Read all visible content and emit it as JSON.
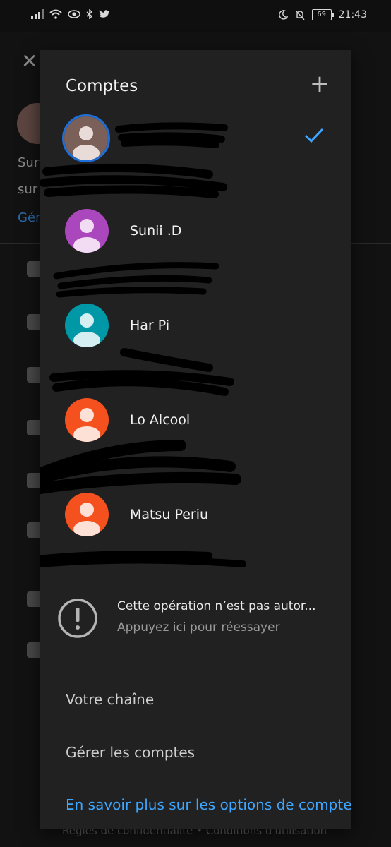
{
  "status_bar": {
    "time": "21:43",
    "battery": "69",
    "icons": [
      "signal-icon",
      "wifi-icon",
      "eye-icon",
      "bluetooth-icon",
      "twitter-icon",
      "moon-icon",
      "bell-off-icon",
      "battery-icon"
    ]
  },
  "background": {
    "text1": "Sur",
    "text2": "sur",
    "link": "Gér",
    "footer": "Règles de confidentialité  •  Conditions d'utilisation"
  },
  "modal": {
    "title": "Comptes",
    "add_label": "+",
    "accounts": [
      {
        "name": "",
        "avatar_color": "#7a6058",
        "selected": true
      },
      {
        "name": "Sunii .D",
        "avatar_color": "#ab47bc",
        "selected": false
      },
      {
        "name": "Har Pi",
        "avatar_color": "#0097a7",
        "selected": false
      },
      {
        "name": "Lo Alcool",
        "avatar_color": "#f4511e",
        "selected": false
      },
      {
        "name": "Matsu Periu",
        "avatar_color": "#f4511e",
        "selected": false
      }
    ],
    "error": {
      "title": "Cette opération n’est pas autor...",
      "subtitle": "Appuyez ici pour réessayer"
    },
    "menu": {
      "channel": "Votre chaîne",
      "manage": "Gérer les comptes",
      "learn_more": "En savoir plus sur les options de compte"
    }
  },
  "colors": {
    "accent": "#3ea6ff",
    "selected_ring": "#1e6fd9",
    "modal_bg": "#212121"
  }
}
